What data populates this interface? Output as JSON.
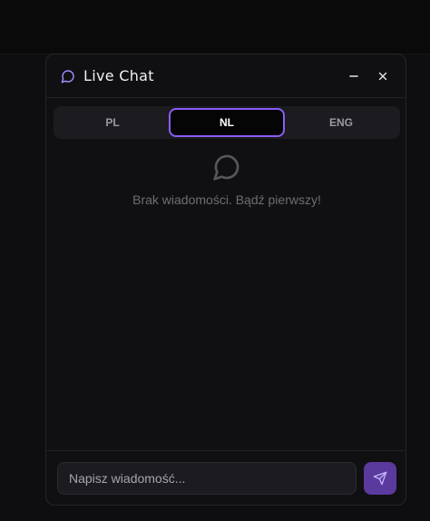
{
  "header": {
    "title": "Live Chat",
    "title_icon": "chat-bubble-icon",
    "minimize_icon": "minus-icon",
    "close_icon": "close-icon"
  },
  "tabs": [
    {
      "label": "PL",
      "active": false
    },
    {
      "label": "NL",
      "active": true
    },
    {
      "label": "ENG",
      "active": false
    }
  ],
  "empty_state": {
    "icon": "chat-bubble-icon",
    "message": "Brak wiadomości. Bądź pierwszy!"
  },
  "composer": {
    "placeholder": "Napisz wiadomość...",
    "value": "",
    "send_icon": "send-icon"
  },
  "colors": {
    "accent": "#8b5cf6",
    "send_button": "#5b3a9e",
    "panel": "#101013"
  }
}
